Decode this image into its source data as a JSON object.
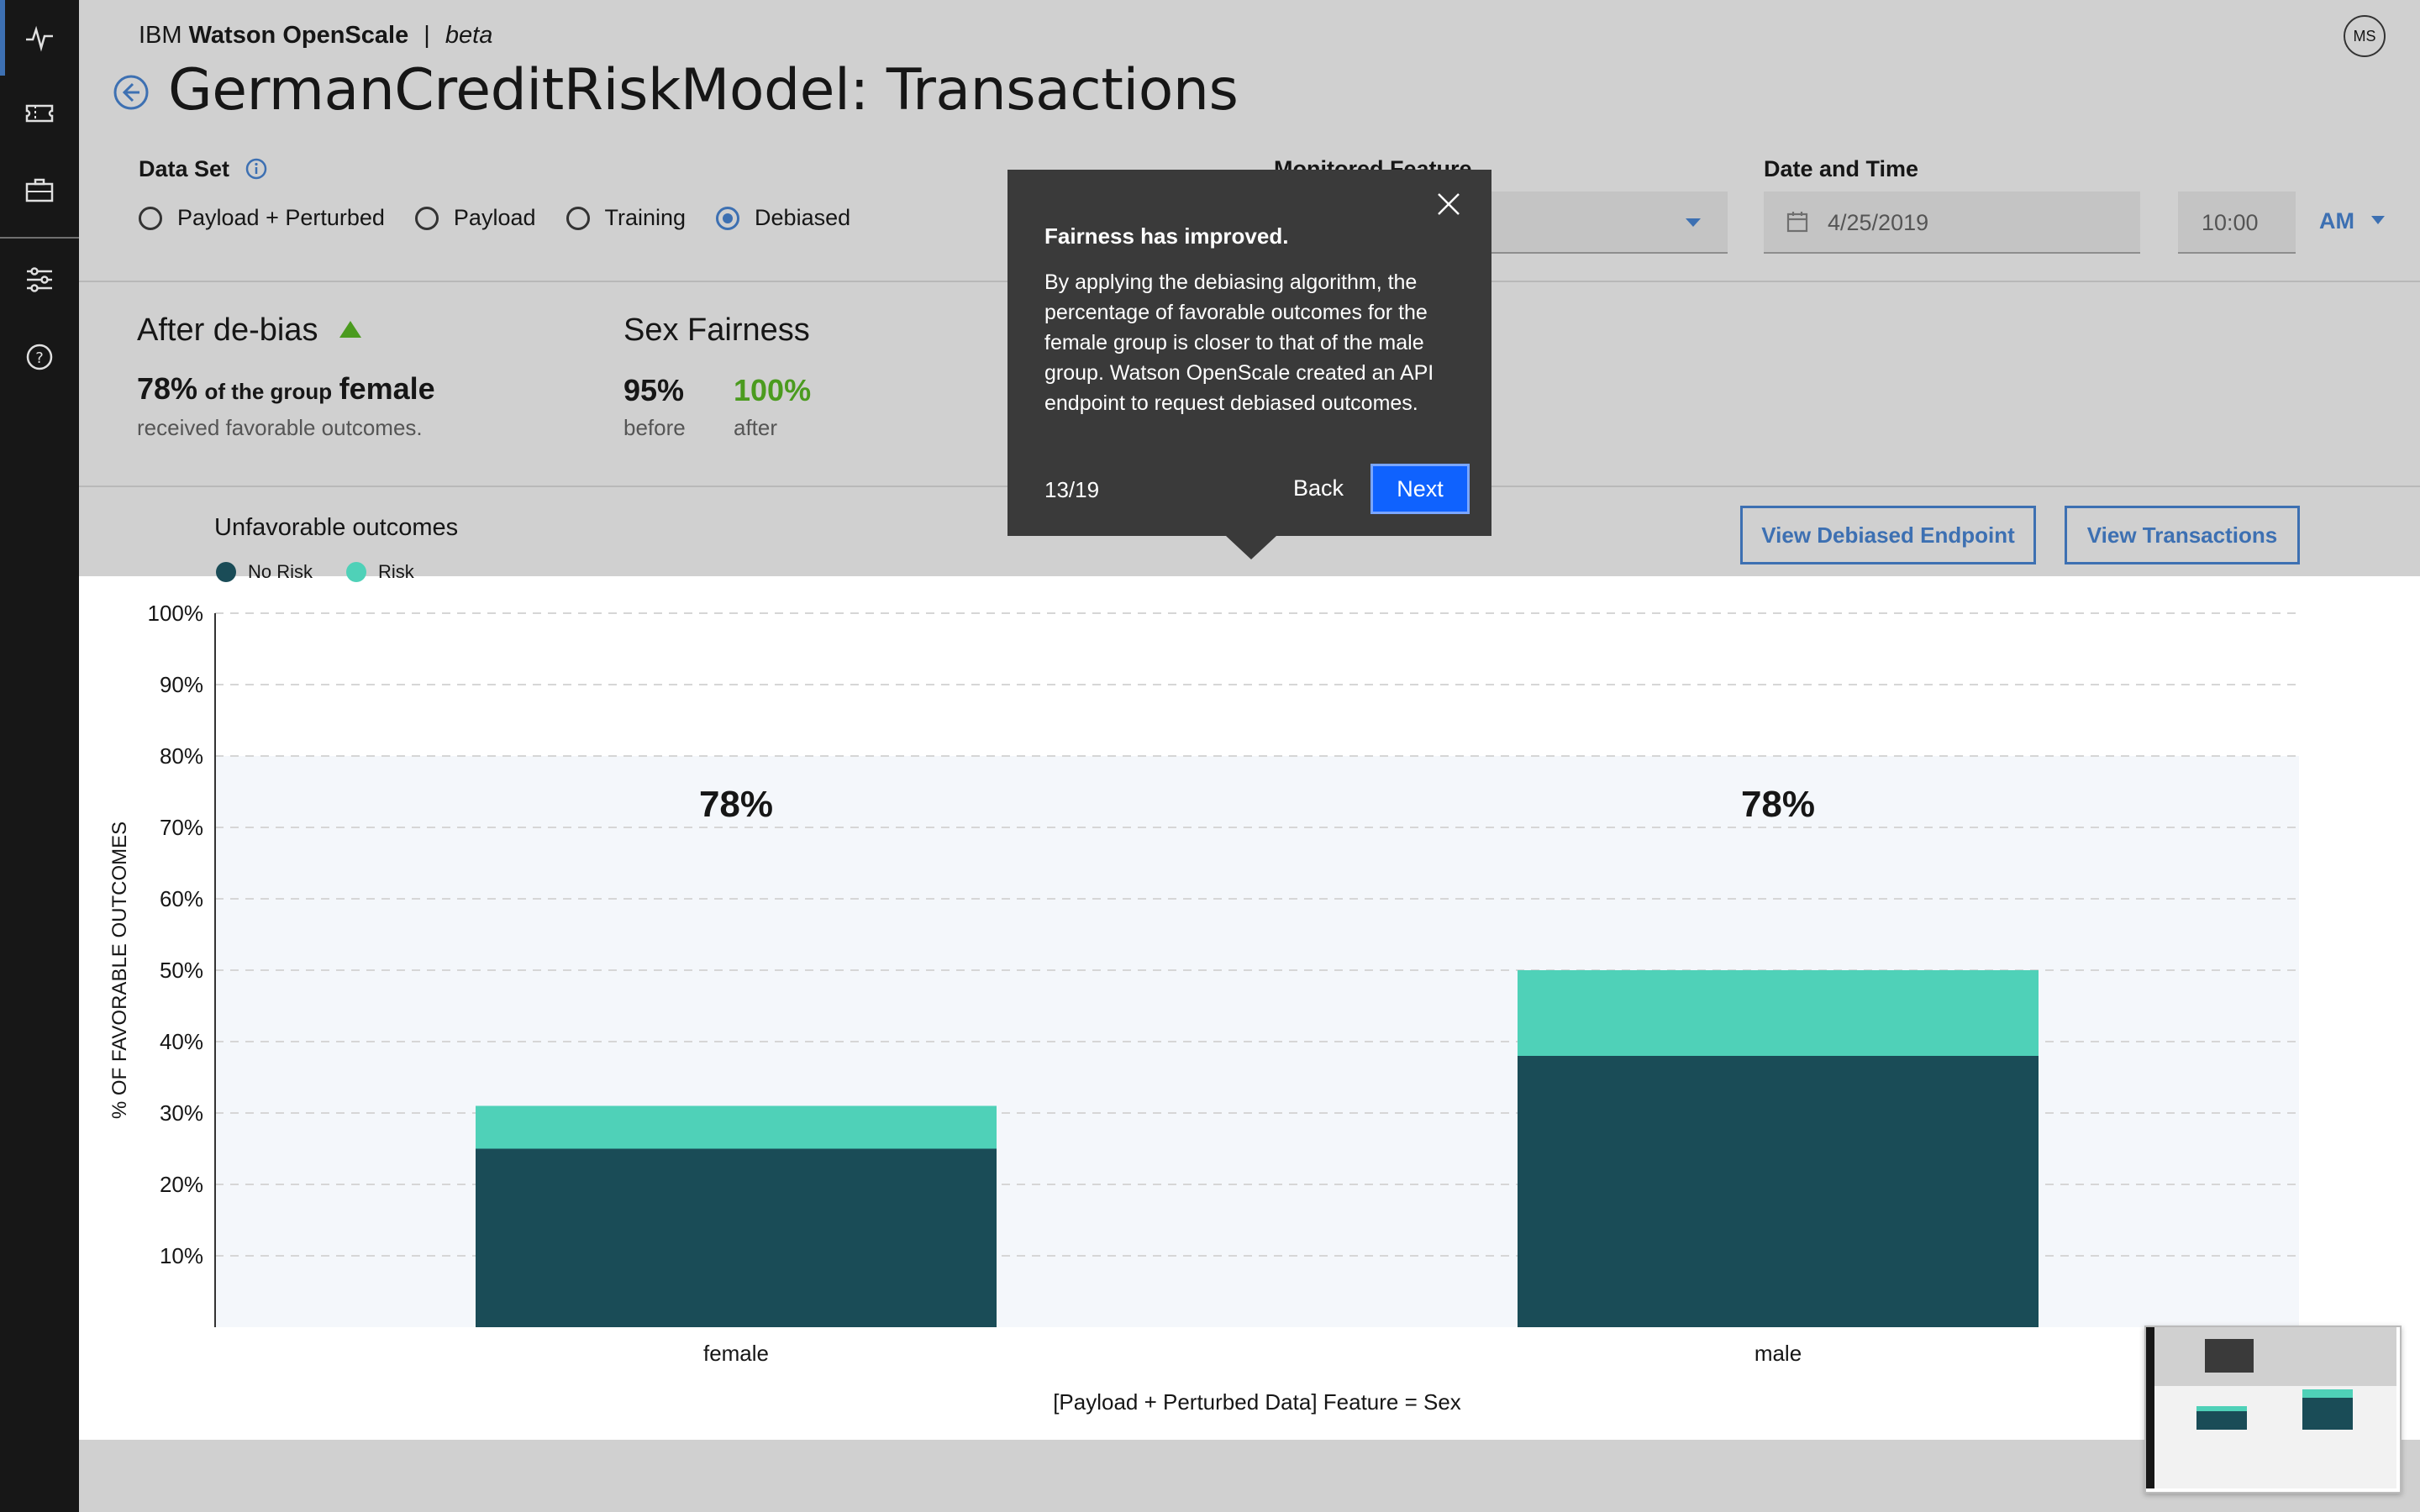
{
  "header": {
    "brand_prefix": "IBM ",
    "brand_bold": "Watson OpenScale",
    "separator": "|",
    "brand_tag": "beta",
    "avatar_initials": "MS"
  },
  "page": {
    "title": "GermanCreditRiskModel: Transactions"
  },
  "dataset": {
    "label": "Data Set",
    "options": [
      "Payload + Perturbed",
      "Payload",
      "Training",
      "Debiased"
    ],
    "selected": "Debiased"
  },
  "monitored_feature": {
    "label": "Monitored Feature"
  },
  "date_time": {
    "label": "Date and Time",
    "date": "4/25/2019",
    "time": "10:00",
    "ampm": "AM"
  },
  "summary": {
    "after_heading": "After de-bias",
    "pct": "78%",
    "of_group": "of the group",
    "group": "female",
    "received": "received favorable outcomes.",
    "fairness_heading": "Sex Fairness",
    "before_value": "95%",
    "before_label": "before",
    "after_value": "100%",
    "after_label": "after"
  },
  "buttons": {
    "debiased_endpoint": "View Debiased Endpoint",
    "transactions": "View Transactions"
  },
  "legend": {
    "title": "Unfavorable outcomes",
    "no_risk": "No Risk",
    "risk": "Risk"
  },
  "tooltip": {
    "title": "Fairness has improved.",
    "body": "By applying the debiasing algorithm, the percentage of favorable outcomes for the female group is closer to that of the male group. Watson OpenScale created an API endpoint to request debiased outcomes.",
    "step": "13/19",
    "back": "Back",
    "next": "Next"
  },
  "colors": {
    "no_risk": "#1a4c57",
    "risk": "#4fd1b8",
    "accent": "#3d70b2",
    "positive": "#4b9b1f"
  },
  "chart_data": {
    "type": "bar",
    "stacked": true,
    "categories": [
      "female",
      "male"
    ],
    "series": [
      {
        "name": "No Risk",
        "values": [
          25,
          38
        ]
      },
      {
        "name": "Risk",
        "values": [
          6,
          12
        ]
      }
    ],
    "bar_labels": [
      "78%",
      "78%"
    ],
    "ylabel": "% OF FAVORABLE OUTCOMES",
    "xlabel": "[Payload + Perturbed Data] Feature = Sex",
    "ylim": [
      0,
      100
    ],
    "yticks": [
      "10%",
      "20%",
      "30%",
      "40%",
      "50%",
      "60%",
      "70%",
      "80%",
      "90%",
      "100%"
    ],
    "shaded_band_below": 80
  }
}
